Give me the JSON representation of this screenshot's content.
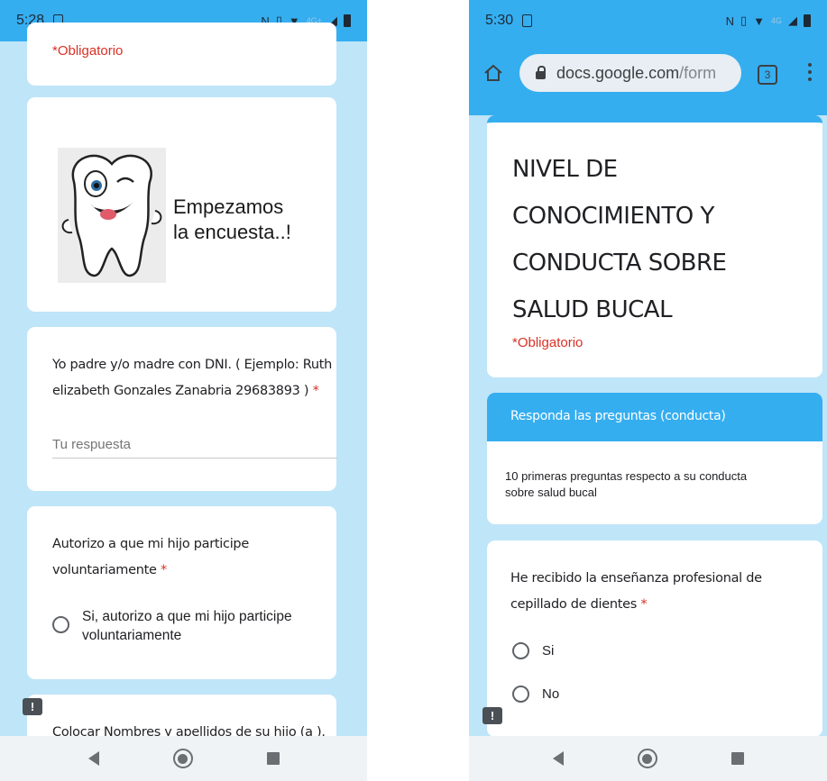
{
  "left_phone": {
    "status": {
      "time": "5:28",
      "net": "4G+"
    },
    "required_note": "*Obligatorio",
    "image_text_line1": "Empezamos",
    "image_text_line2": "la encuesta..!",
    "q1": {
      "line1": "Yo padre y/o madre con DNI. ( Ejemplo: Ruth",
      "line2": "elizabeth Gonzales Zanabria 29683893 )",
      "asterisk": "*",
      "placeholder": "Tu respuesta"
    },
    "q2": {
      "line1": "Autorizo a que mi hijo participe",
      "line2": "voluntariamente",
      "asterisk": "*",
      "option_line1": "Si, autorizo a que mi hijo participe",
      "option_line2": "voluntariamente"
    },
    "q3": {
      "line1": "Colocar Nombres y apellidos de su hijo (a )."
    },
    "feedback_label": "!"
  },
  "right_phone": {
    "status": {
      "time": "5:30",
      "net": "4G"
    },
    "url_domain": "docs.google.com",
    "url_path": "/form",
    "tab_count": "3",
    "title_lines": [
      "NIVEL DE",
      "CONOCIMIENTO Y",
      "CONDUCTA SOBRE",
      "SALUD BUCAL"
    ],
    "required_note": "*Obligatorio",
    "section_title": "Responda las preguntas (conducta)",
    "section_desc_line1": "10 primeras preguntas respecto a su conducta",
    "section_desc_line2": "sobre salud bucal",
    "q1": {
      "line1": "He recibido la enseñanza profesional de",
      "line2": "cepillado de dientes",
      "asterisk": "*",
      "options": [
        "Si",
        "No"
      ]
    },
    "feedback_label": "!"
  },
  "colors": {
    "accent": "#35aef0",
    "page_bg": "#bfe5f8",
    "required": "#d93025"
  },
  "icons": [
    "home-icon",
    "lock-icon",
    "tabs-icon",
    "menu-icon",
    "back-icon",
    "home-nav-icon",
    "recents-icon",
    "feedback-icon",
    "tooth-mascot"
  ]
}
